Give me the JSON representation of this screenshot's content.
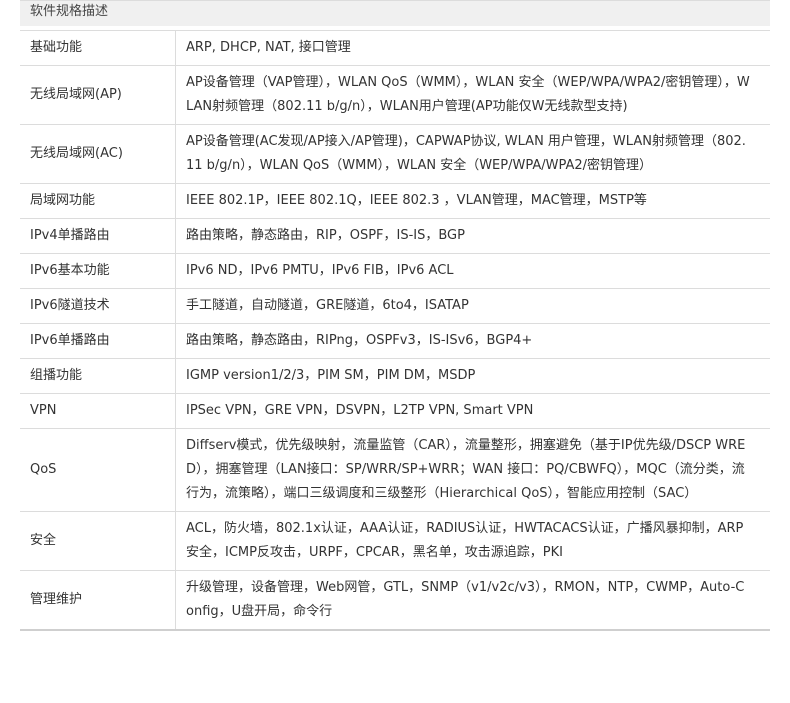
{
  "header": {
    "title": "软件规格描述"
  },
  "specs": [
    {
      "label": "基础功能",
      "value": "ARP, DHCP, NAT, 接口管理"
    },
    {
      "label": "无线局域网(AP)",
      "value": "AP设备管理（VAP管理），WLAN QoS（WMM），WLAN 安全（WEP/WPA/WPA2/密钥管理），WLAN射频管理（802.11 b/g/n），WLAN用户管理(AP功能仅W无线款型支持)"
    },
    {
      "label": "无线局域网(AC)",
      "value": "AP设备管理(AC发现/AP接入/AP管理)，CAPWAP协议, WLAN 用户管理，WLAN射频管理（802.11 b/g/n），WLAN QoS（WMM），WLAN 安全（WEP/WPA/WPA2/密钥管理）"
    },
    {
      "label": "局域网功能",
      "value": "IEEE 802.1P，IEEE 802.1Q，IEEE 802.3 ，VLAN管理，MAC管理，MSTP等"
    },
    {
      "label": "IPv4单播路由",
      "value": "路由策略，静态路由，RIP，OSPF，IS-IS，BGP"
    },
    {
      "label": "IPv6基本功能",
      "value": "IPv6 ND，IPv6 PMTU，IPv6 FIB，IPv6 ACL"
    },
    {
      "label": "IPv6隧道技术",
      "value": "手工隧道，自动隧道，GRE隧道，6to4，ISATAP"
    },
    {
      "label": "IPv6单播路由",
      "value": "路由策略，静态路由，RIPng，OSPFv3，IS-ISv6，BGP4+"
    },
    {
      "label": "组播功能",
      "value": "IGMP version1/2/3，PIM SM，PIM DM，MSDP"
    },
    {
      "label": "VPN",
      "value": "IPSec VPN，GRE VPN，DSVPN，L2TP VPN, Smart VPN"
    },
    {
      "label": "QoS",
      "value": "Diffserv模式，优先级映射，流量监管（CAR），流量整形，拥塞避免（基于IP优先级/DSCP WRED），拥塞管理（LAN接口：SP/WRR/SP+WRR；WAN 接口：PQ/CBWFQ），MQC（流分类，流行为，流策略），端口三级调度和三级整形（Hierarchical QoS），智能应用控制（SAC）"
    },
    {
      "label": "安全",
      "value": "ACL，防火墙，802.1x认证，AAA认证，RADIUS认证，HWTACACS认证，广播风暴抑制，ARP安全，ICMP反攻击，URPF，CPCAR，黑名单，攻击源追踪，PKI"
    },
    {
      "label": "管理维护",
      "value": "升级管理，设备管理，Web网管，GTL，SNMP（v1/v2c/v3），RMON，NTP，CWMP，Auto-Config，U盘开局，命令行"
    }
  ]
}
